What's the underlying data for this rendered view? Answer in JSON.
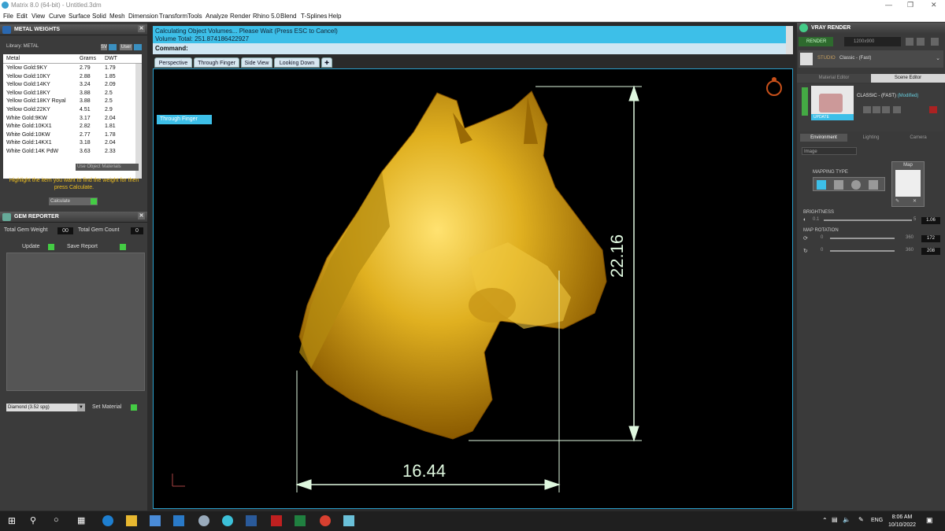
{
  "window": {
    "title": "Matrix 8.0 (64-bit) - Untitled.3dm"
  },
  "menu": [
    "File",
    "Edit",
    "View",
    "Curve",
    "Surface",
    "Solid",
    "Mesh",
    "Dimension",
    "Transform",
    "Tools",
    "Analyze",
    "Render",
    "Rhino 5.0",
    "Blend",
    "T-Splines",
    "Help"
  ],
  "metal_weights": {
    "title": "METAL WEIGHTS",
    "library_label": "Library: METAL",
    "sv_label": "SV",
    "user_label": "User",
    "columns": [
      "Metal",
      "Grams",
      "DWT"
    ],
    "rows": [
      [
        "Yellow Gold:9KY",
        "2.79",
        "1.79"
      ],
      [
        "Yellow Gold:10KY",
        "2.88",
        "1.85"
      ],
      [
        "Yellow Gold:14KY",
        "3.24",
        "2.09"
      ],
      [
        "Yellow Gold:18KY",
        "3.88",
        "2.5"
      ],
      [
        "Yellow Gold:18KY Royal",
        "3.88",
        "2.5"
      ],
      [
        "Yellow Gold:22KY",
        "4.51",
        "2.9"
      ],
      [
        "White Gold:9KW",
        "3.17",
        "2.04"
      ],
      [
        "White Gold:10KX1",
        "2.82",
        "1.81"
      ],
      [
        "White Gold:10KW",
        "2.77",
        "1.78"
      ],
      [
        "White Gold:14KX1",
        "3.18",
        "2.04"
      ],
      [
        "White Gold:14K PdW",
        "3.63",
        "2.33"
      ]
    ],
    "use_object_materials": "Use Object Materials",
    "hint": "Highlight the item you want to find the weight for then press Calculate.",
    "calculate": "Calculate"
  },
  "gem_reporter": {
    "title": "GEM REPORTER",
    "total_weight_label": "Total Gem Weight",
    "total_weight": "00",
    "total_count_label": "Total Gem Count",
    "total_count": "0",
    "update": "Update",
    "save_report": "Save Report",
    "gem_select": "Diamond    (3.52 spg)",
    "set_material": "Set Material"
  },
  "status": {
    "line1": "Calculating Object Volumes... Please Wait (Press ESC to Cancel)",
    "line2": "Volume Total: 251.874186422927",
    "command_label": "Command:"
  },
  "viewport_tabs": [
    "Perspective",
    "Through Finger",
    "Side View",
    "Looking Down"
  ],
  "active_viewport": "Through Finger",
  "dimensions": {
    "height": "22.16",
    "width": "16.44"
  },
  "vray": {
    "title": "VRAY RENDER",
    "render": "RENDER",
    "resolution": "1200x900",
    "studio": "STUDIO",
    "preset": "Classic - (Fast)",
    "tabs": [
      "Material Editor",
      "Scene Editor"
    ],
    "material_name": "CLASSIC - (FAST)",
    "material_state": "(Modified)",
    "update": "UPDATE",
    "env_tabs": [
      "Environment",
      "Lighting",
      "Camera"
    ],
    "image_select": "Image",
    "mapping_type": "MAPPING TYPE",
    "map_label": "Map",
    "brightness_label": "BRIGHTNESS",
    "brightness_min": "0.1",
    "brightness_max": "5",
    "brightness_value": "1.06",
    "map_rotation_label": "MAP ROTATION",
    "rot1_min": "0",
    "rot1_max": "360",
    "rot1_value": "172",
    "rot2_min": "0",
    "rot2_max": "360",
    "rot2_value": "208"
  },
  "taskbar": {
    "lang": "ENG",
    "time": "8:06 AM",
    "date": "10/10/2022"
  },
  "colors": {
    "accent": "#3dbfe8",
    "gold": "#d4a017",
    "dimension": "#dff8df"
  }
}
